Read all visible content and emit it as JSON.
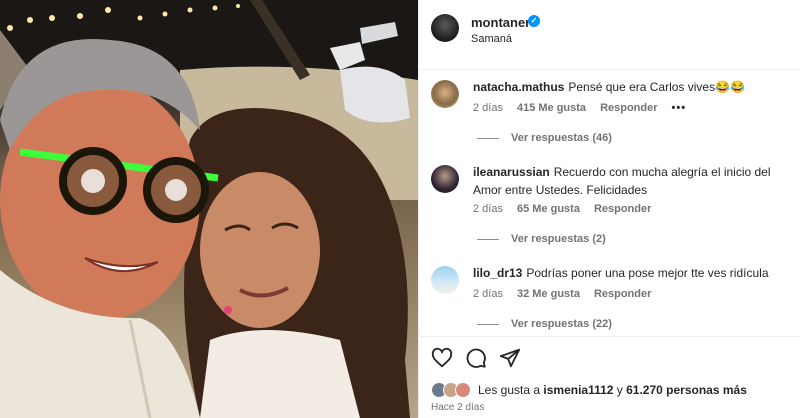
{
  "post": {
    "username": "montaner",
    "location": "Samaná"
  },
  "comments": [
    {
      "username": "natacha.mathus",
      "text": "Pensé que era Carlos vives😂😂",
      "time": "2 días",
      "likes": "415 Me gusta",
      "reply": "Responder",
      "more": "•••",
      "replies": "Ver respuestas (46)"
    },
    {
      "username": "ileanarussian",
      "text": "Recuerdo con mucha alegría el inicio del Amor entre Ustedes. Felicidades",
      "time": "2 días",
      "likes": "65 Me gusta",
      "reply": "Responder",
      "replies": "Ver respuestas (2)"
    },
    {
      "username": "lilo_dr13",
      "text": "Podrías poner una pose mejor tte ves ridícula",
      "time": "2 días",
      "likes": "32 Me gusta",
      "reply": "Responder",
      "replies": "Ver respuestas (22)"
    }
  ],
  "likes_summary": {
    "prefix": "Les gusta a ",
    "user": "ismenia1112",
    "middle": " y ",
    "count": "61.270 personas más"
  },
  "time_ago": "Hace 2 días",
  "icons": [
    "heart-icon",
    "comment-icon",
    "share-icon",
    "verified-icon"
  ],
  "colors": {
    "verified": "#0095f6",
    "secondary_text": "#737373",
    "divider": "#efefef"
  }
}
